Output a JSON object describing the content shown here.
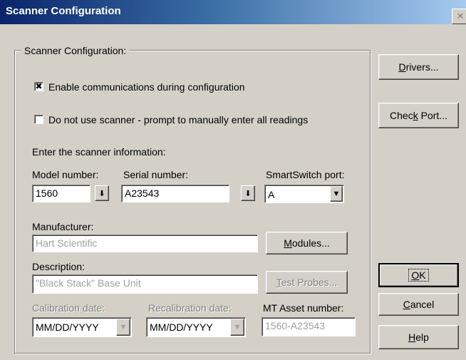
{
  "window": {
    "title": "Scanner Configuration",
    "close_glyph": "✕"
  },
  "group": {
    "title": "Scanner Configuration:"
  },
  "checkboxes": {
    "enable_comms": {
      "label": "Enable communications during configuration",
      "checked": true,
      "mark": "✖"
    },
    "no_scanner": {
      "label": "Do not use scanner - prompt to manually enter all readings",
      "checked": false,
      "mark": ""
    }
  },
  "info_heading": "Enter the scanner information:",
  "model": {
    "label": "Model number:",
    "value": "1560"
  },
  "serial": {
    "label": "Serial number:",
    "value": "A23543"
  },
  "smartswitch": {
    "label": "SmartSwitch port:",
    "value": "A"
  },
  "manufacturer": {
    "label": "Manufacturer:",
    "value": "Hart Scientific"
  },
  "description": {
    "label": "Description:",
    "value": "\"Black Stack\" Base Unit"
  },
  "calibration": {
    "label": "Calibration date:",
    "value": "MM/DD/YYYY"
  },
  "recalibration": {
    "label": "Recalibration date:",
    "value": "MM/DD/YYYY"
  },
  "asset": {
    "label": "MT Asset number:",
    "value": "1560-A23543"
  },
  "buttons": {
    "modules": {
      "pre": "",
      "ul": "M",
      "post": "odules..."
    },
    "test_probes": {
      "pre": "",
      "ul": "T",
      "post": "est Probes..."
    },
    "drivers": {
      "pre": "",
      "ul": "D",
      "post": "rivers..."
    },
    "check_port": {
      "pre": "Chec",
      "ul": "k",
      "post": " Port..."
    },
    "ok": {
      "pre": "",
      "ul": "O",
      "post": "K"
    },
    "cancel": {
      "pre": "",
      "ul": "C",
      "post": "ancel"
    },
    "help": {
      "pre": "",
      "ul": "H",
      "post": "elp"
    }
  },
  "icons": {
    "down_arrow_stroke": "⬇",
    "combo_arrow": "▼"
  }
}
